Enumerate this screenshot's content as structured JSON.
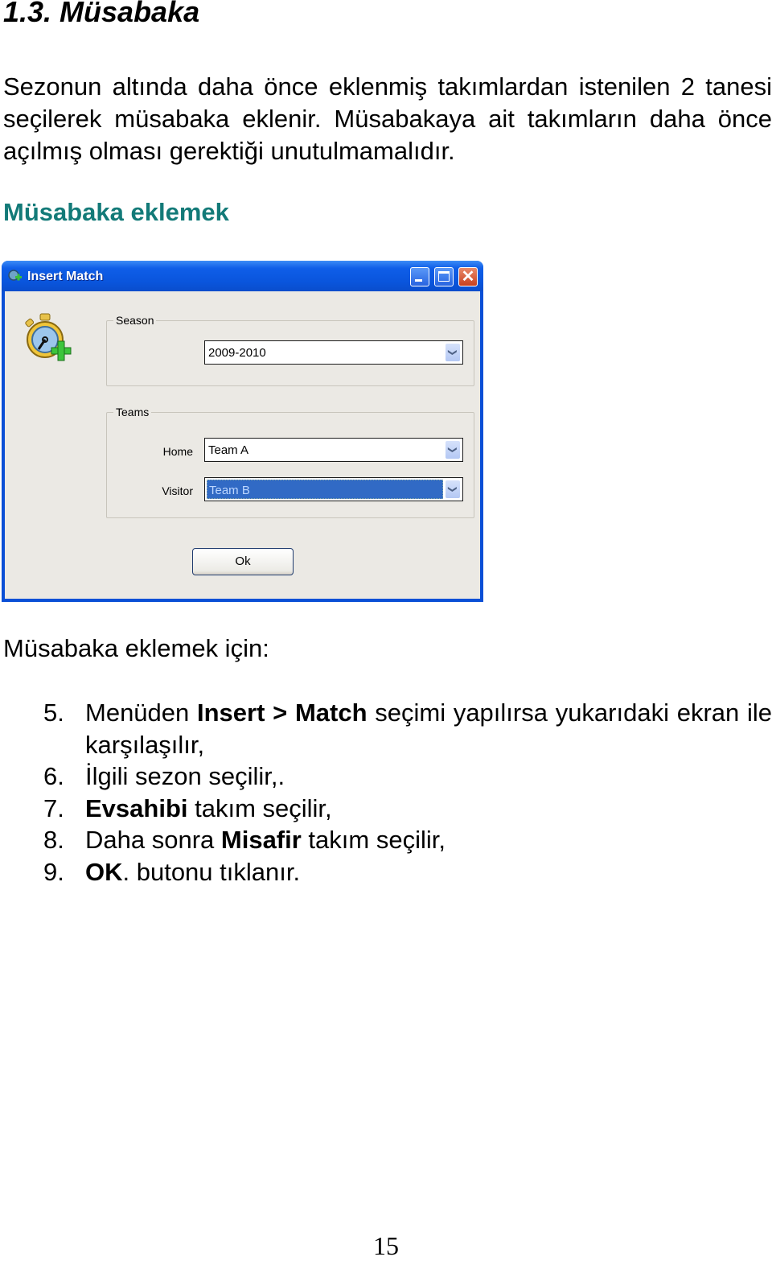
{
  "document": {
    "section_title": "1.3. Müsabaka",
    "intro_paragraph": "Sezonun altında daha önce eklenmiş takımlardan istenilen 2 tanesi seçilerek müsabaka eklenir. Müsabakaya ait takımların daha önce açılmış olması gerektiği unutulmamalıdır.",
    "subheading": "Müsabaka eklemek",
    "subheading_color": "#137a78",
    "steps_intro": "Müsabaka eklemek için:",
    "steps": [
      {
        "num": "5.",
        "parts": [
          {
            "t": "Menüden "
          },
          {
            "b": "Insert > Match"
          },
          {
            "t": " seçimi yapılırsa yukarıdaki ekran ile karşılaşılır,"
          }
        ]
      },
      {
        "num": "6.",
        "parts": [
          {
            "t": "İlgili sezon seçilir,."
          }
        ]
      },
      {
        "num": "7.",
        "parts": [
          {
            "b": "Evsahibi"
          },
          {
            "t": " takım seçilir,"
          }
        ]
      },
      {
        "num": "8.",
        "parts": [
          {
            "t": "Daha sonra "
          },
          {
            "b": "Misafir"
          },
          {
            "t": " takım seçilir,"
          }
        ]
      },
      {
        "num": "9.",
        "parts": [
          {
            "b": "OK"
          },
          {
            "t": ". butonu tıklanır."
          }
        ]
      }
    ],
    "page_number": "15"
  },
  "window": {
    "title": "Insert Match",
    "title_icon": "app-icon",
    "controls": {
      "minimize": "minimize-icon",
      "maximize": "maximize-icon",
      "close": "close-icon",
      "close_glyph": "✕"
    },
    "illustration_icon": "stopwatch-add-icon",
    "season_group": {
      "label": "Season",
      "selected": "2009-2010"
    },
    "teams_group": {
      "label": "Teams",
      "home_label": "Home",
      "home_selected": "Team A",
      "visitor_label": "Visitor",
      "visitor_selected": "Team B"
    },
    "dropdown_glyph": "❯",
    "ok_label": "Ok"
  }
}
